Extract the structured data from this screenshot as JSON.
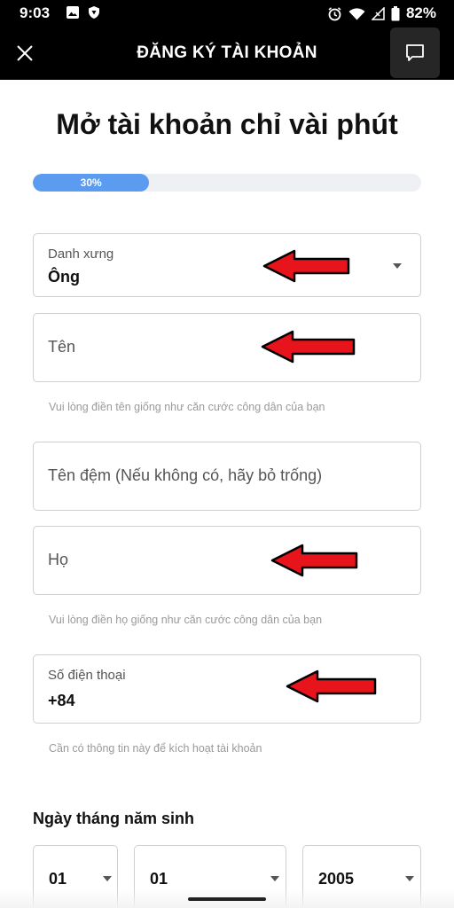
{
  "status_bar": {
    "time": "9:03",
    "battery_percent": "82%",
    "icons_left": [
      "image-icon",
      "shield-icon"
    ],
    "icons_right": [
      "alarm-icon",
      "wifi-icon",
      "signal-icon",
      "battery-icon"
    ]
  },
  "header": {
    "title": "ĐĂNG KÝ TÀI KHOẢN",
    "close_icon": "close-icon",
    "chat_icon": "chat-icon"
  },
  "page_title": "Mở tài khoản chỉ vài phút",
  "progress": {
    "label": "30%",
    "fraction": 0.3,
    "color": "#5b9cf0"
  },
  "form": {
    "salutation": {
      "label": "Danh xưng",
      "value": "Ông"
    },
    "first_name": {
      "placeholder": "Tên",
      "helper": "Vui lòng điền tên giống như căn cước công dân của bạn"
    },
    "middle_name": {
      "placeholder": "Tên đệm (Nếu không có, hãy bỏ trống)"
    },
    "last_name": {
      "placeholder": "Họ",
      "helper": "Vui lòng điền họ giống như căn cước công dân của bạn"
    },
    "phone": {
      "label": "Số điện thoại",
      "value": "+84",
      "helper": "Cần có thông tin này để kích hoạt tài khoản"
    }
  },
  "dob": {
    "title": "Ngày tháng năm sinh",
    "day": "01",
    "month": "01",
    "year": "2005"
  },
  "annotation_color": "#e8141c"
}
